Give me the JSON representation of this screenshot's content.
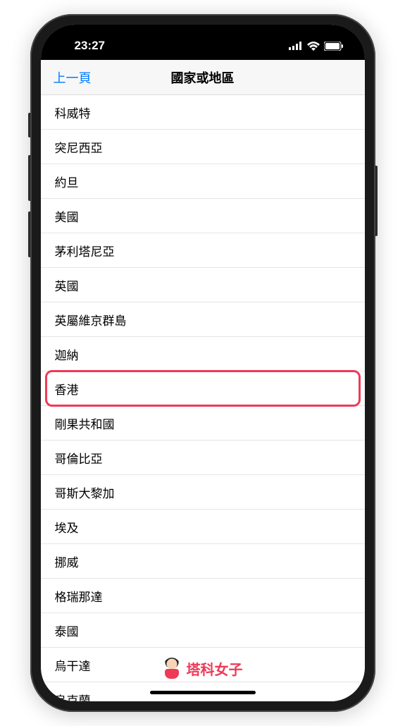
{
  "statusBar": {
    "time": "23:27"
  },
  "navBar": {
    "backLabel": "上一頁",
    "title": "國家或地區"
  },
  "countries": [
    {
      "label": "科威特",
      "highlighted": false
    },
    {
      "label": "突尼西亞",
      "highlighted": false
    },
    {
      "label": "約旦",
      "highlighted": false
    },
    {
      "label": "美國",
      "highlighted": false
    },
    {
      "label": "茅利塔尼亞",
      "highlighted": false
    },
    {
      "label": "英國",
      "highlighted": false
    },
    {
      "label": "英屬維京群島",
      "highlighted": false
    },
    {
      "label": "迦納",
      "highlighted": false
    },
    {
      "label": "香港",
      "highlighted": true
    },
    {
      "label": "剛果共和國",
      "highlighted": false
    },
    {
      "label": "哥倫比亞",
      "highlighted": false
    },
    {
      "label": "哥斯大黎加",
      "highlighted": false
    },
    {
      "label": "埃及",
      "highlighted": false
    },
    {
      "label": "挪威",
      "highlighted": false
    },
    {
      "label": "格瑞那達",
      "highlighted": false
    },
    {
      "label": "泰國",
      "highlighted": false
    },
    {
      "label": "烏干達",
      "highlighted": false
    },
    {
      "label": "烏克蘭",
      "highlighted": false
    }
  ],
  "watermark": {
    "text": "塔科女子"
  }
}
